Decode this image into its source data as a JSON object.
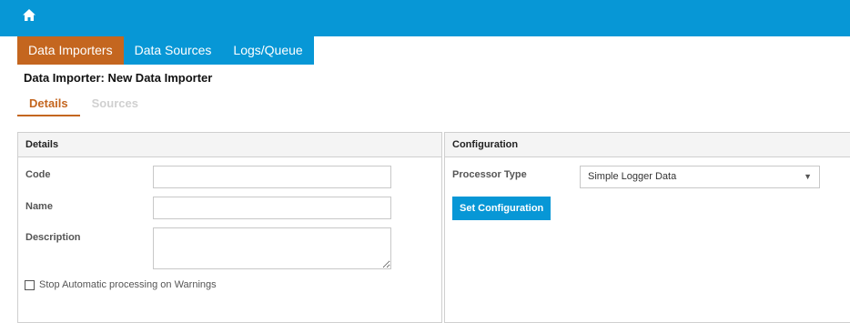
{
  "header": {
    "home_icon": "home-icon",
    "background_color": "#0797d6"
  },
  "nav": {
    "items": [
      {
        "label": "Data Importers",
        "active": true
      },
      {
        "label": "Data Sources",
        "active": false
      },
      {
        "label": "Logs/Queue",
        "active": false
      }
    ],
    "active_color": "#c4661f"
  },
  "page": {
    "title": "Data Importer: New Data Importer"
  },
  "tabs": [
    {
      "label": "Details",
      "active": true
    },
    {
      "label": "Sources",
      "active": false
    }
  ],
  "details_panel": {
    "title": "Details",
    "code_label": "Code",
    "code_value": "",
    "name_label": "Name",
    "name_value": "",
    "description_label": "Description",
    "description_value": "",
    "stop_checkbox_label": "Stop Automatic processing on Warnings",
    "stop_checkbox_checked": false
  },
  "configuration_panel": {
    "title": "Configuration",
    "processor_type_label": "Processor Type",
    "processor_type_value": "Simple Logger Data",
    "set_configuration_label": "Set Configuration"
  }
}
